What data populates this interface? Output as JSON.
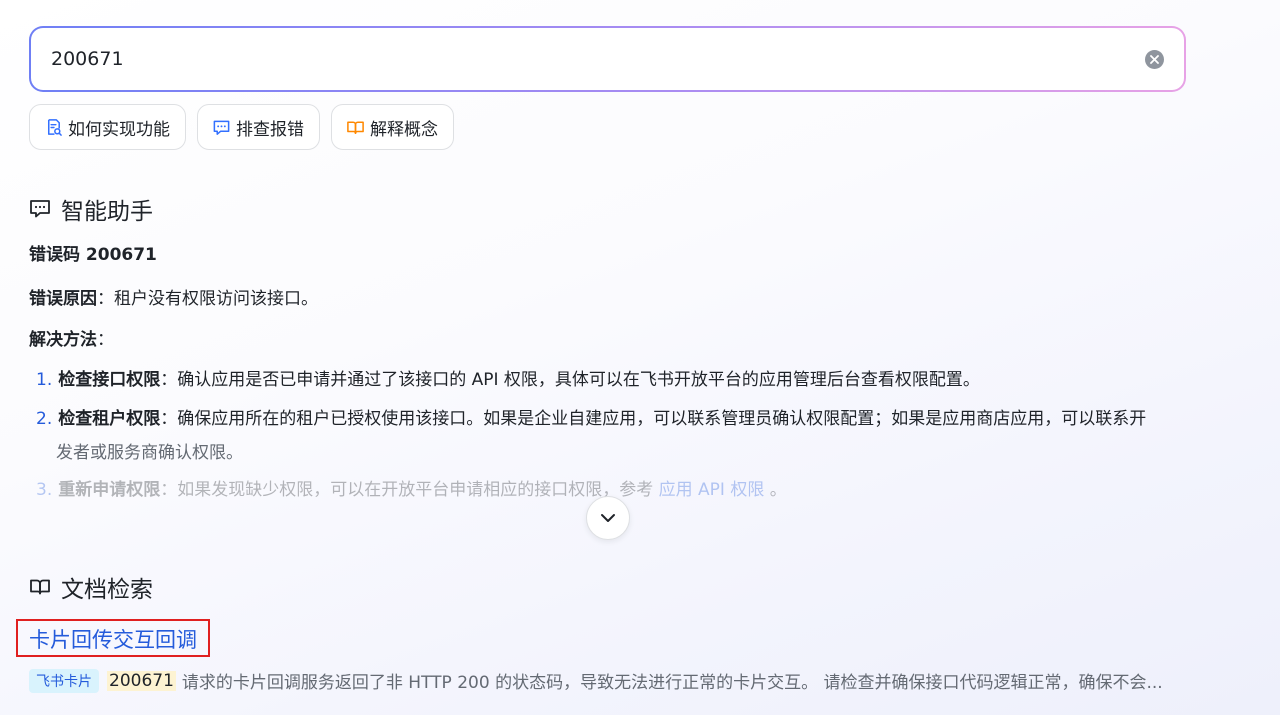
{
  "search": {
    "value": "200671"
  },
  "chips": [
    {
      "label": "如何实现功能",
      "icon": "doc-search-icon",
      "color": "#3370ff"
    },
    {
      "label": "排查报错",
      "icon": "chat-bug-icon",
      "color": "#3370ff"
    },
    {
      "label": "解释概念",
      "icon": "open-book-icon",
      "color": "#ff8800"
    }
  ],
  "assistant": {
    "title": "智能助手",
    "error_heading": "错误码 200671",
    "cause_label": "错误原因",
    "cause_text": "：租户没有权限访问该接口。",
    "solution_label": "解决方法",
    "solution_suffix": "：",
    "items": [
      {
        "num": "1.",
        "title": "检查接口权限",
        "text": "：确认应用是否已申请并通过了该接口的 API 权限，具体可以在飞书开放平台的应用管理后台查看权限配置。"
      },
      {
        "num": "2.",
        "title": "检查租户权限",
        "text": "：确保应用所在的租户已授权使用该接口。如果是企业自建应用，可以联系管理员确认权限配置；如果是应用商店应用，可以联系开",
        "text_cont": "发者或服务商确认权限。"
      },
      {
        "num": "3.",
        "title": "重新申请权限",
        "text": "：如果发现缺少权限，可以在开放平台申请相应的接口权限，参考 ",
        "link": "应用 API 权限",
        "text_end": " 。"
      }
    ]
  },
  "docs": {
    "title": "文档检索",
    "result": {
      "title": "卡片回传交互回调",
      "tag": "飞书卡片",
      "highlight": "200671",
      "snippet": "请求的卡片回调服务返回了非 HTTP 200 的状态码，导致无法进行正常的卡片交互。 请检查并确保接口代码逻辑正常，确保不会..."
    }
  }
}
